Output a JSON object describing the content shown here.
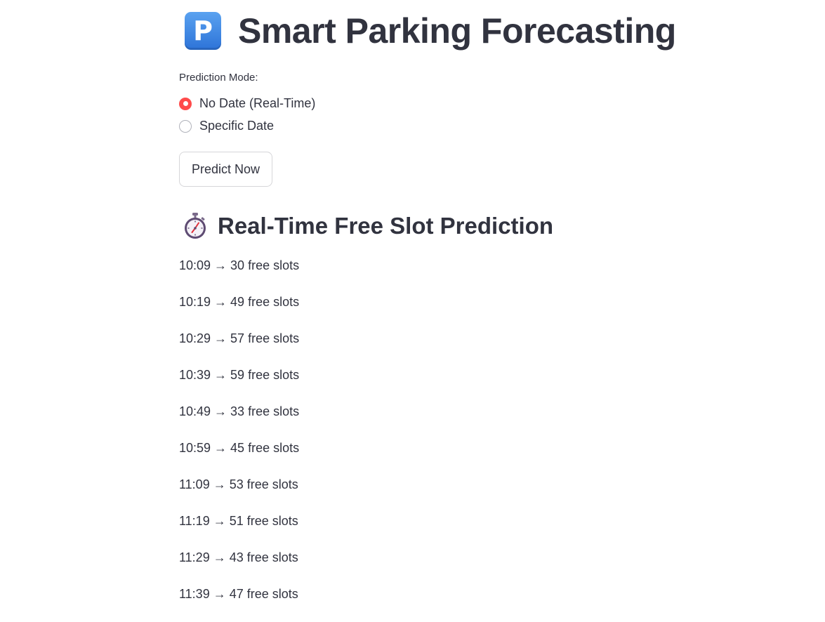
{
  "header": {
    "icon": "parking-p-icon",
    "icon_glyph": "P",
    "title": "Smart Parking Forecasting"
  },
  "mode": {
    "label": "Prediction Mode:",
    "options": [
      {
        "label": "No Date (Real-Time)",
        "selected": true
      },
      {
        "label": "Specific Date",
        "selected": false
      }
    ]
  },
  "button": {
    "predict_label": "Predict Now"
  },
  "results": {
    "icon": "stopwatch-icon",
    "title": "Real-Time Free Slot Prediction",
    "items": [
      {
        "time": "10:09",
        "arrow": "→",
        "slots": 30,
        "text": "10:09 → 30 free slots"
      },
      {
        "time": "10:19",
        "arrow": "→",
        "slots": 49,
        "text": "10:19 → 49 free slots"
      },
      {
        "time": "10:29",
        "arrow": "→",
        "slots": 57,
        "text": "10:29 → 57 free slots"
      },
      {
        "time": "10:39",
        "arrow": "→",
        "slots": 59,
        "text": "10:39 → 59 free slots"
      },
      {
        "time": "10:49",
        "arrow": "→",
        "slots": 33,
        "text": "10:49 → 33 free slots"
      },
      {
        "time": "10:59",
        "arrow": "→",
        "slots": 45,
        "text": "10:59 → 45 free slots"
      },
      {
        "time": "11:09",
        "arrow": "→",
        "slots": 53,
        "text": "11:09 → 53 free slots"
      },
      {
        "time": "11:19",
        "arrow": "→",
        "slots": 51,
        "text": "11:19 → 51 free slots"
      },
      {
        "time": "11:29",
        "arrow": "→",
        "slots": 43,
        "text": "11:29 → 43 free slots"
      },
      {
        "time": "11:39",
        "arrow": "→",
        "slots": 47,
        "text": "11:39 → 47 free slots"
      }
    ]
  },
  "colors": {
    "accent": "#ff4b4b",
    "text": "#31333f",
    "parking_icon": "#3d86e3"
  }
}
